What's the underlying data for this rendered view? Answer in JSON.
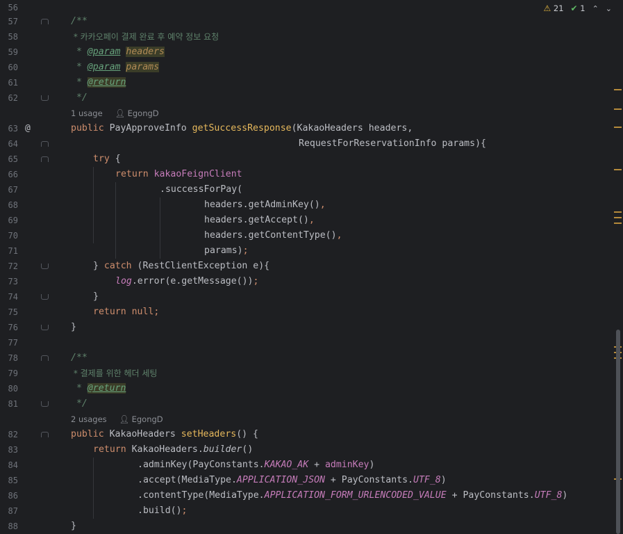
{
  "status": {
    "warnings_count": "21",
    "checks_count": "1",
    "warning_icon": "warning-triangle-icon",
    "check_icon": "double-check-icon",
    "up_icon": "chevron-up-icon",
    "down_icon": "chevron-down-icon"
  },
  "line_numbers": [
    "56",
    "57",
    "58",
    "59",
    "60",
    "61",
    "62",
    "63",
    "64",
    "65",
    "66",
    "67",
    "68",
    "69",
    "70",
    "71",
    "72",
    "73",
    "74",
    "75",
    "76",
    "77",
    "78",
    "79",
    "80",
    "81",
    "82",
    "83",
    "84",
    "85",
    "86",
    "87",
    "88"
  ],
  "inlays": [
    {
      "usage": "1 usage",
      "author": "EgongD"
    },
    {
      "usage": "2 usages",
      "author": "EgongD"
    }
  ],
  "code": {
    "l57": "/**",
    "l58_text": " * 카카오페이 결제 완료 후 예약 정보 요청",
    "l59_star": " * ",
    "l59_tag": "@param",
    "l59_name": "headers",
    "l60_star": " * ",
    "l60_tag": "@param",
    "l60_name": "params",
    "l61_star": " * ",
    "l61_tag": "@return",
    "l62": " */",
    "l63_kw": "public ",
    "l63_type": "PayApproveInfo ",
    "l63_fn": "getSuccessResponse",
    "l63_rest": "(KakaoHeaders headers,",
    "l64": "RequestForReservationInfo params){",
    "l65_kw": "try",
    "l65_rest": " {",
    "l66_kw": "return ",
    "l66_fld": "kakaoFeignClient",
    "l67": ".successForPay(",
    "l68_a": "headers.getAdminKey()",
    "l68_b": ",",
    "l69_a": "headers.getAccept()",
    "l69_b": ",",
    "l70_a": "headers.getContentType()",
    "l70_b": ",",
    "l71_a": "params)",
    "l71_b": ";",
    "l72_a": "} ",
    "l72_kw": "catch",
    "l72_b": " (RestClientException e){",
    "l73_log": "log",
    "l73_rest": ".error(e.getMessage())",
    "l73_semi": ";",
    "l74": "}",
    "l75_kw": "return ",
    "l75_null": "null",
    "l75_semi": ";",
    "l76": "}",
    "l78": "/**",
    "l79_text": " * 결제를 위한 헤더 세팅",
    "l80_star": " * ",
    "l80_tag": "@return",
    "l81": " */",
    "l82_kw": "public ",
    "l82_type": "KakaoHeaders ",
    "l82_fn": "setHeaders",
    "l82_rest": "() {",
    "l83_kw": "return ",
    "l83_a": "KakaoHeaders.",
    "l83_static": "builder",
    "l83_b": "()",
    "l84_a": ".adminKey(PayConstants.",
    "l84_const": "KAKAO_AK",
    "l84_b": " + ",
    "l84_fld": "adminKey",
    "l84_c": ")",
    "l85_a": ".accept(MediaType.",
    "l85_const": "APPLICATION_JSON",
    "l85_b": " + PayConstants.",
    "l85_const2": "UTF_8",
    "l85_c": ")",
    "l86_a": ".contentType(MediaType.",
    "l86_const": "APPLICATION_FORM_URLENCODED_VALUE",
    "l86_b": " + PayConstants.",
    "l86_const2": "UTF_8",
    "l86_c": ")",
    "l87_a": ".build()",
    "l87_semi": ";",
    "l88": "}"
  },
  "colors": {
    "background": "#1e1f22",
    "keyword": "#cf8e6d",
    "function_decl": "#e6b85c",
    "field": "#c77dbb",
    "comment": "#5f826b",
    "warning_marker": "#b58a3b"
  }
}
